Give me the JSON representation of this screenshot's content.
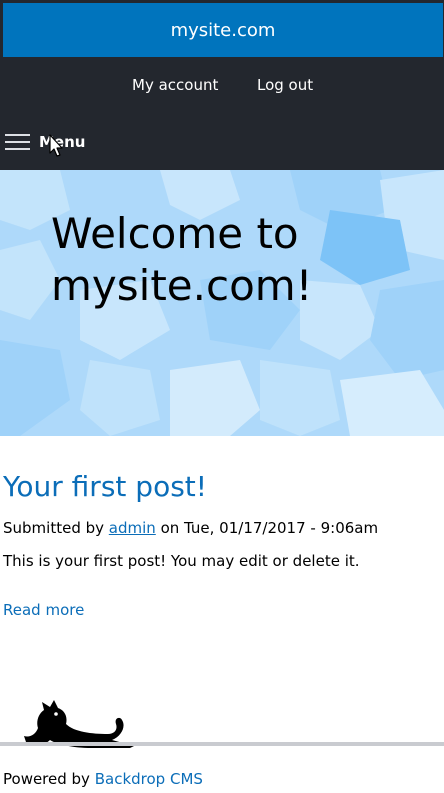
{
  "site": {
    "name": "mysite.com"
  },
  "account_menu": {
    "my_account": "My account",
    "log_out": "Log out"
  },
  "menu": {
    "label": "Menu"
  },
  "hero": {
    "title": "Welcome to mysite.com!"
  },
  "post": {
    "title": "Your first post!",
    "submitted_prefix": "Submitted by",
    "author": "admin",
    "submitted_suffix": "on Tue, 01/17/2017 - 9:06am",
    "body": "This is your first post! You may edit or delete it.",
    "read_more": "Read more"
  },
  "footer": {
    "powered_by": "Powered by",
    "cms_name": "Backdrop CMS"
  },
  "colors": {
    "header_blue": "#0074bd",
    "dark_bar": "#23272e",
    "link_blue": "#0b6db8",
    "hero_blue": "#aed9fa"
  }
}
